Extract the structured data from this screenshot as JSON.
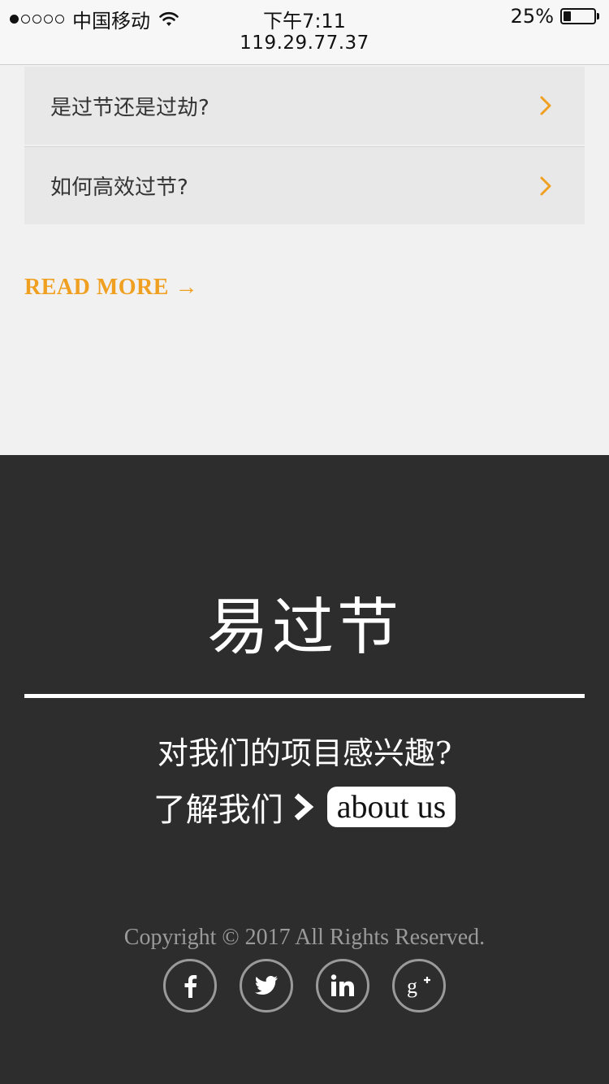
{
  "status_bar": {
    "signal_dots_filled": 1,
    "signal_dots_total": 5,
    "carrier": "中国移动",
    "wifi_icon": "wifi-icon",
    "time": "下午7:11",
    "url": "119.29.77.37",
    "battery_percent": "25%",
    "battery_level": 0.25
  },
  "list": {
    "items": [
      {
        "label": "是过节还是过劫?",
        "icon": "chevron-right-icon"
      },
      {
        "label": "如何高效过节?",
        "icon": "chevron-right-icon"
      }
    ]
  },
  "read_more": "READ MORE →",
  "footer": {
    "brand": "易过节",
    "interest": "对我们的项目感兴趣?",
    "about_label": "了解我们",
    "about_button": "about us",
    "copyright": "Copyright © 2017 All Rights Reserved.",
    "socials": [
      "facebook-icon",
      "twitter-icon",
      "linkedin-icon",
      "google-plus-icon"
    ]
  },
  "colors": {
    "accent": "#f0a020",
    "footer_bg": "#2d2d2d",
    "page_bg": "#f2f1f1",
    "list_bg": "#e9e8e8"
  }
}
